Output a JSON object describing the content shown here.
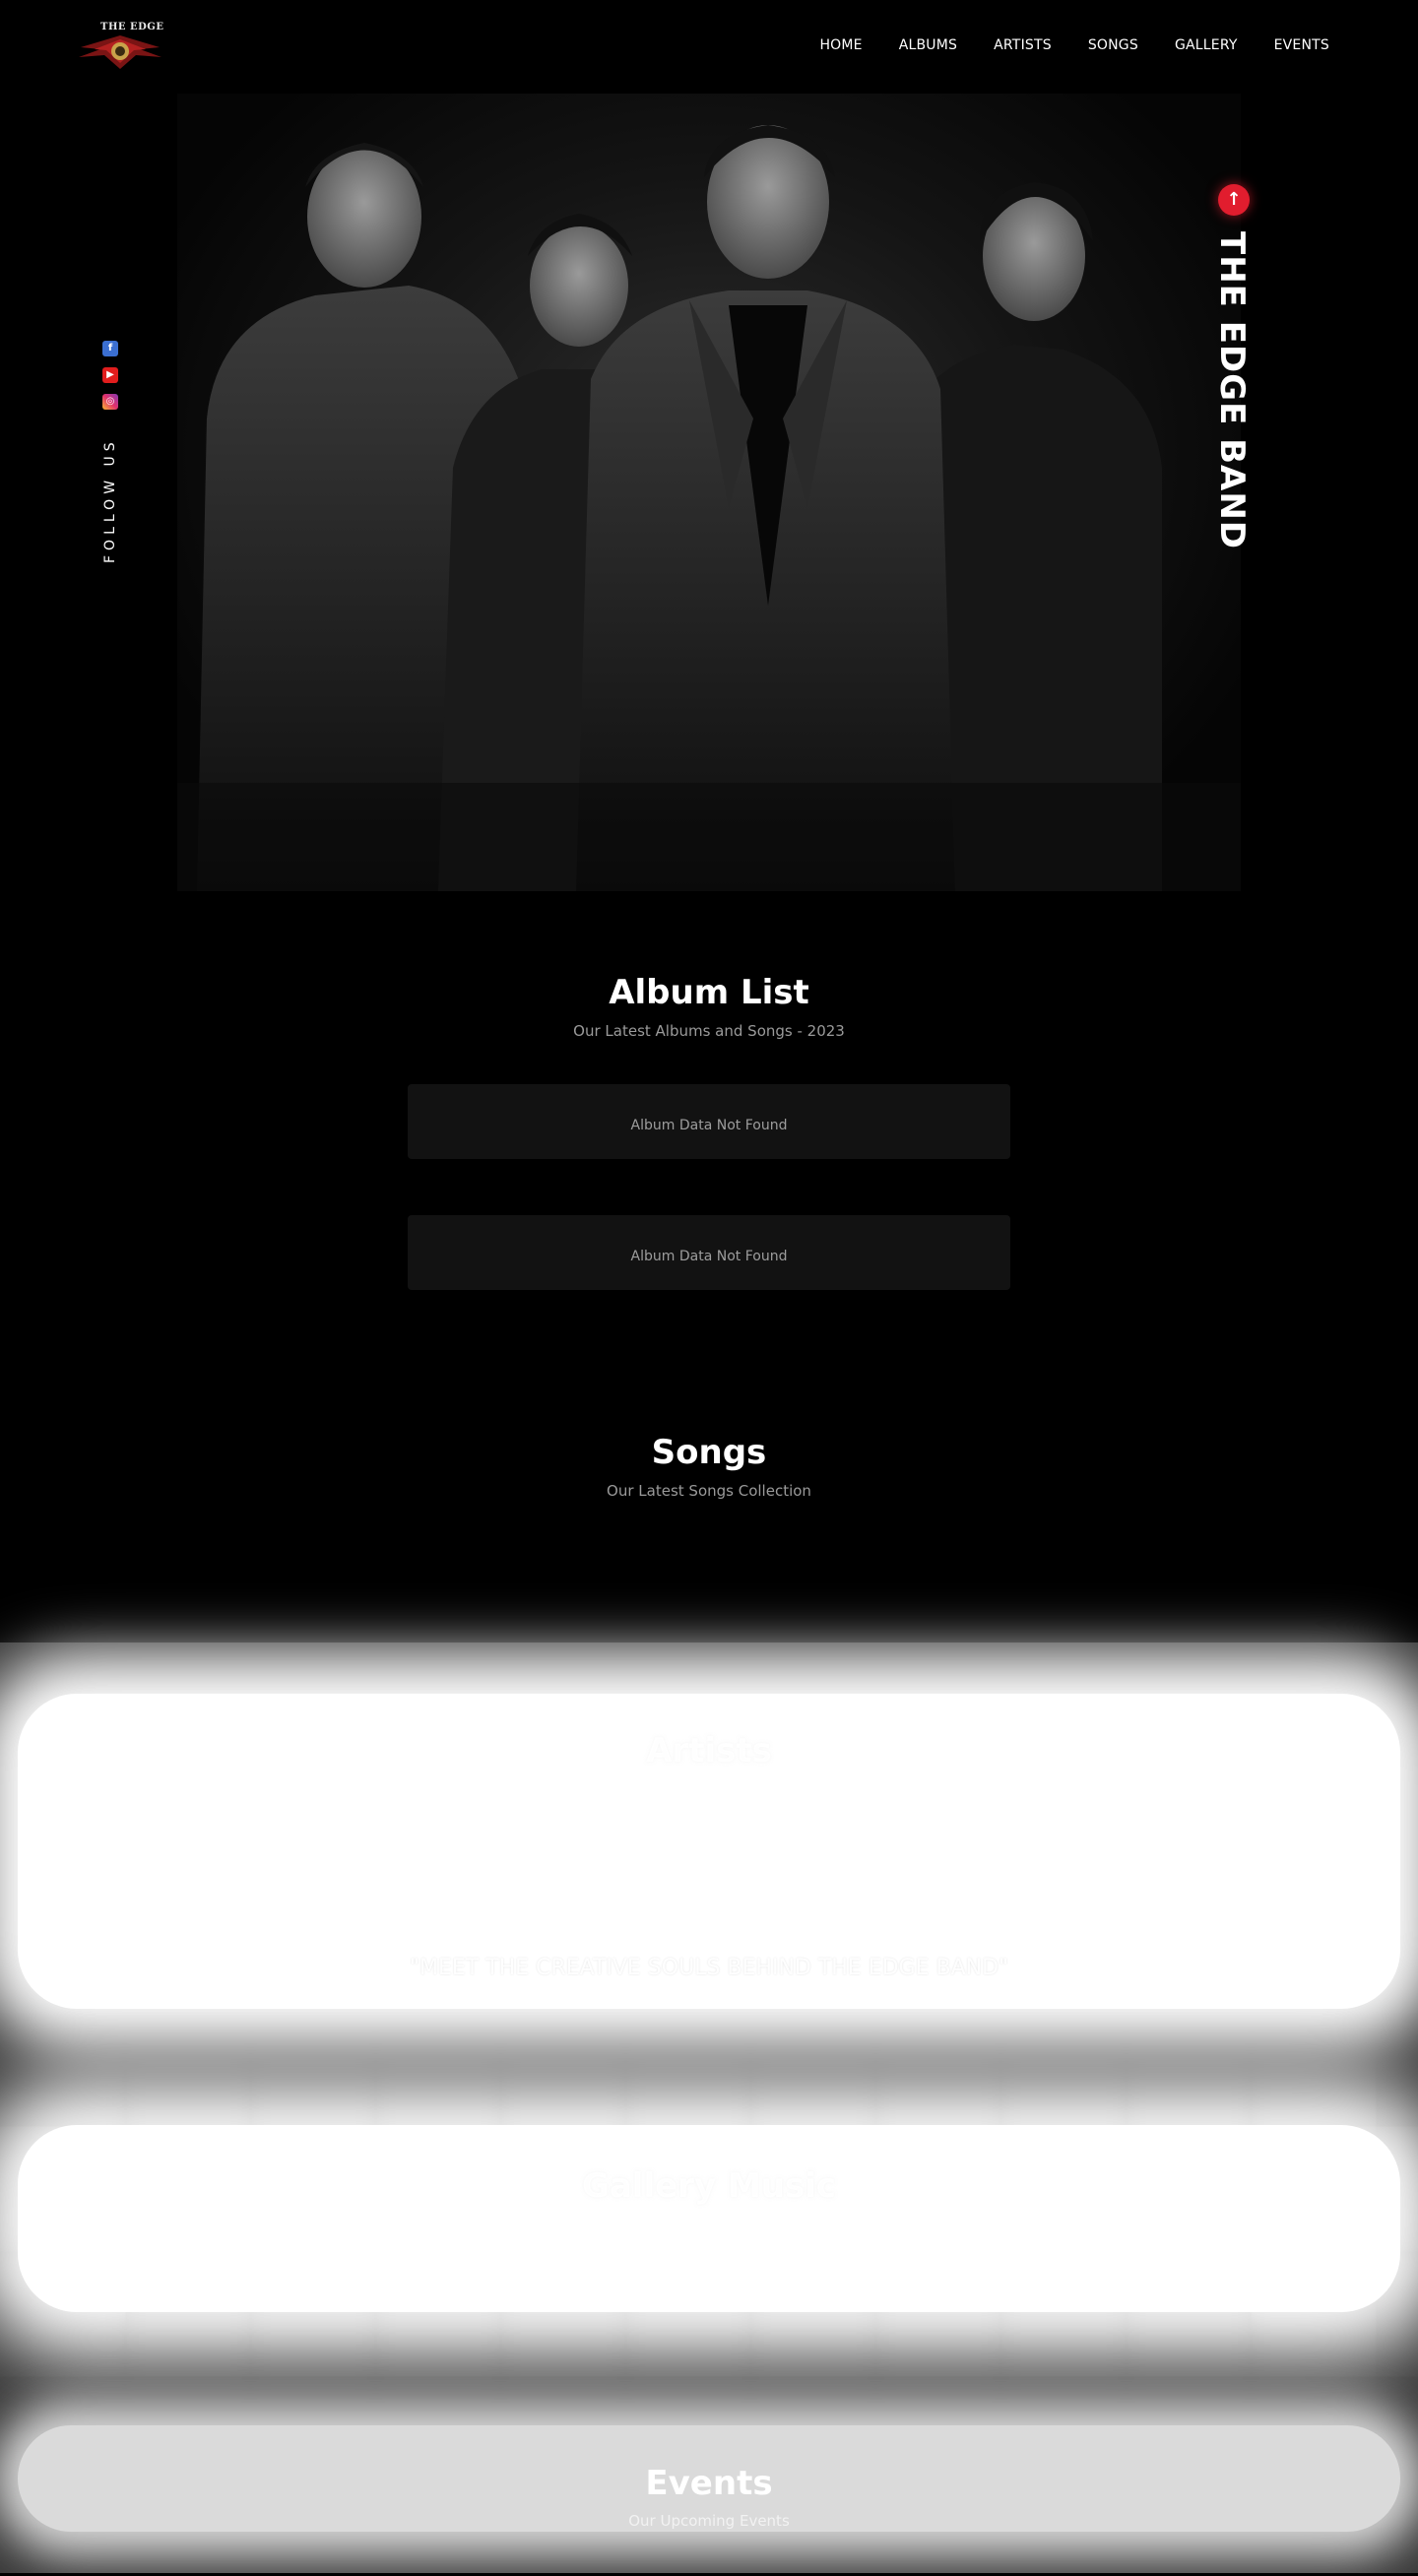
{
  "brand": {
    "logo_text": "THE EDGE",
    "accent_color": "#e11d2e"
  },
  "nav": {
    "items": [
      "HOME",
      "ALBUMS",
      "ARTISTS",
      "SONGS",
      "GALLERY",
      "EVENTS"
    ]
  },
  "hero": {
    "band_name": "THE EDGE BAND",
    "follow_label": "FOLLOW US",
    "scroll_top_icon": "arrow-up-icon",
    "socials": [
      {
        "name": "facebook-icon",
        "glyph": "f",
        "color": "#3b6fd1"
      },
      {
        "name": "youtube-icon",
        "glyph": "▶",
        "color": "#e11d1d"
      },
      {
        "name": "instagram-icon",
        "glyph": "◎",
        "color": "#e1306c"
      }
    ]
  },
  "albums": {
    "title": "Album List",
    "subtitle": "Our Latest Albums and Songs - 2023",
    "cards": [
      "Album Data Not Found",
      "Album Data Not Found"
    ]
  },
  "songs": {
    "title": "Songs",
    "subtitle": "Our Latest Songs Collection"
  },
  "artists": {
    "title": "Artists",
    "quote": "\"MEET THE CREATIVE SOULS BEHIND THE EDGE BAND\""
  },
  "gallery": {
    "title": "Gallery Music"
  },
  "events": {
    "title": "Events",
    "subtitle": "Our Upcoming Events"
  }
}
